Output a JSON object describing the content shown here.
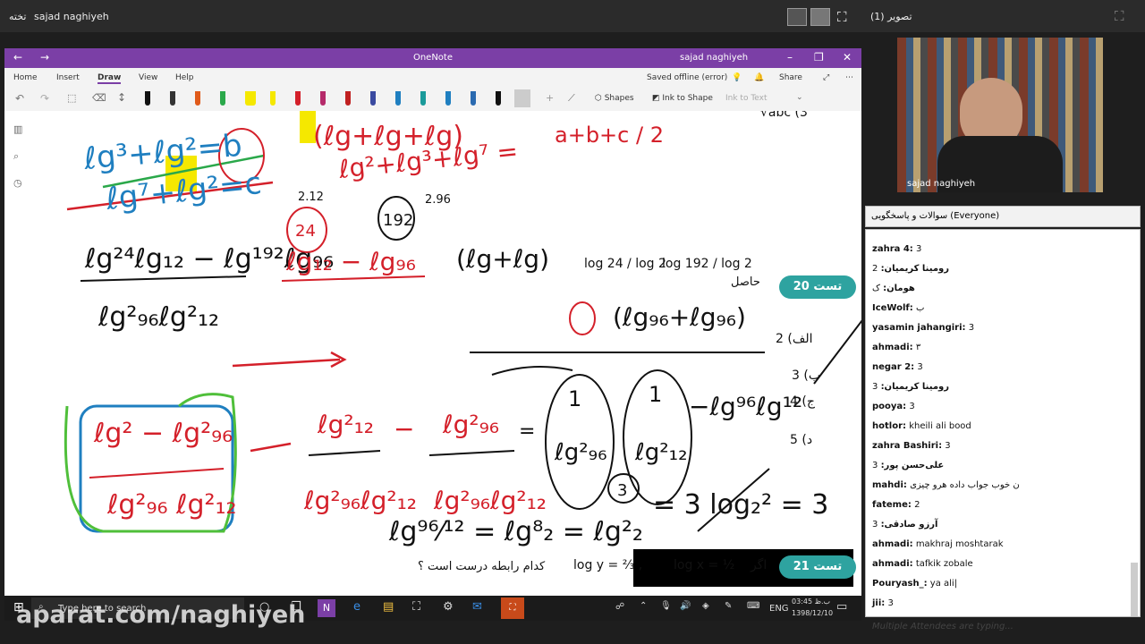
{
  "top": {
    "left_label": "تخته",
    "username": "sajad naghiyeh",
    "right_panel_title": "تصویر (1)"
  },
  "onenote": {
    "app_title": "OneNote",
    "user": "sajad naghiyeh",
    "menu": [
      "Home",
      "Insert",
      "Draw",
      "View",
      "Help"
    ],
    "active_menu": "Draw",
    "status": "Saved offline (error)",
    "share_label": "Share",
    "shapes_label": "Shapes",
    "ink_to_shape_label": "Ink to Shape",
    "ink_to_text_label": "Ink to Text"
  },
  "page": {
    "test20_label": "تست 20",
    "test20_question_prefix": "حاصل",
    "test20_options": [
      "الف) 2",
      "ب) 3",
      "ج) 4",
      "د) 5"
    ],
    "test21_label": "تست 21",
    "test21_condition": "اگر",
    "test21_question": "کدام رابطه درست است ؟",
    "test21_logx": "log x =",
    "test21_logy": "log y =",
    "frac_log24": "log 24 / log 2",
    "frac_log192": "log 192 / log 2",
    "ink_top_right": "a+b+c / 2",
    "ink_212": "2.12",
    "ink_296": "2.96",
    "ink_24": "24",
    "ink_192": "192",
    "ink_three_circle": "3",
    "ink_result": "= 3 log₂² = 3",
    "vabc": "√abc (3"
  },
  "webcam": {
    "name": "sajad naghiyeh"
  },
  "chat": {
    "header": "سوالات و پاسخگویی (Everyone)",
    "messages": [
      {
        "name": "zahra 4:",
        "text": "3"
      },
      {
        "name": "رومینا کریمیان:",
        "text": "2"
      },
      {
        "name": "هومان:",
        "text": "ک"
      },
      {
        "name": "IceWolf:",
        "text": "ب"
      },
      {
        "name": "yasamin jahangiri:",
        "text": "3"
      },
      {
        "name": "ahmadi:",
        "text": "۳"
      },
      {
        "name": "negar 2:",
        "text": "3"
      },
      {
        "name": "رومینا کریمیان:",
        "text": "3"
      },
      {
        "name": "pooya:",
        "text": "3"
      },
      {
        "name": "hotlor:",
        "text": "kheili ali bood"
      },
      {
        "name": "zahra Bashiri:",
        "text": "3"
      },
      {
        "name": "علی‌حسن پور:",
        "text": "3"
      },
      {
        "name": "mahdi:",
        "text": "ن خوب جواب داده هرو چیزی"
      },
      {
        "name": "fateme:",
        "text": "2"
      },
      {
        "name": "آرزو صادقی:",
        "text": "3"
      },
      {
        "name": "ahmadi:",
        "text": "makhraj moshtarak"
      },
      {
        "name": "ahmadi:",
        "text": "tafkik zobale"
      },
      {
        "name": "Pouryash_:",
        "text": "ya ali|"
      },
      {
        "name": "jii:",
        "text": "3"
      }
    ],
    "typing": "Multiple Attendees are typing..."
  },
  "taskbar": {
    "search_placeholder": "Type here to search",
    "lang": "ENG",
    "time": "03:45 ب.ظ",
    "date": "1398/12/10"
  },
  "watermark": "aparat.com/naghiyeh",
  "colors": {
    "onenote_purple": "#7b3fa6",
    "badge_teal": "#2ea3a0",
    "ink_red": "#d4202a",
    "ink_blue": "#1f7fc0",
    "ink_green": "#4fbf3a",
    "ink_black": "#111111",
    "highlight_yellow": "#f5e800"
  }
}
